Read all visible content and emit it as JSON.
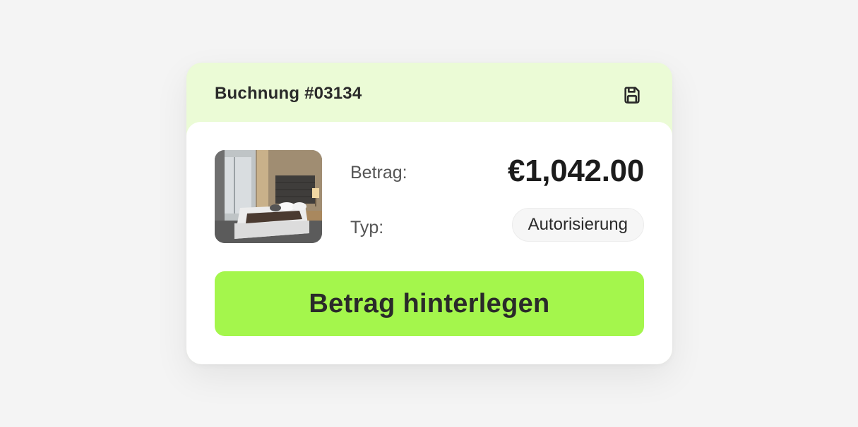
{
  "booking": {
    "title": "Buchnung #03134",
    "save_icon": "save-icon"
  },
  "details": {
    "amount_label": "Betrag:",
    "amount_value": "€1,042.00",
    "type_label": "Typ:",
    "type_value": "Autorisierung",
    "image": "hotel-room-photo"
  },
  "action": {
    "button_label": "Betrag hinterlegen"
  },
  "colors": {
    "header_bg": "#ebfbd6",
    "accent": "#a4f64c",
    "page_bg": "#f4f4f4"
  }
}
